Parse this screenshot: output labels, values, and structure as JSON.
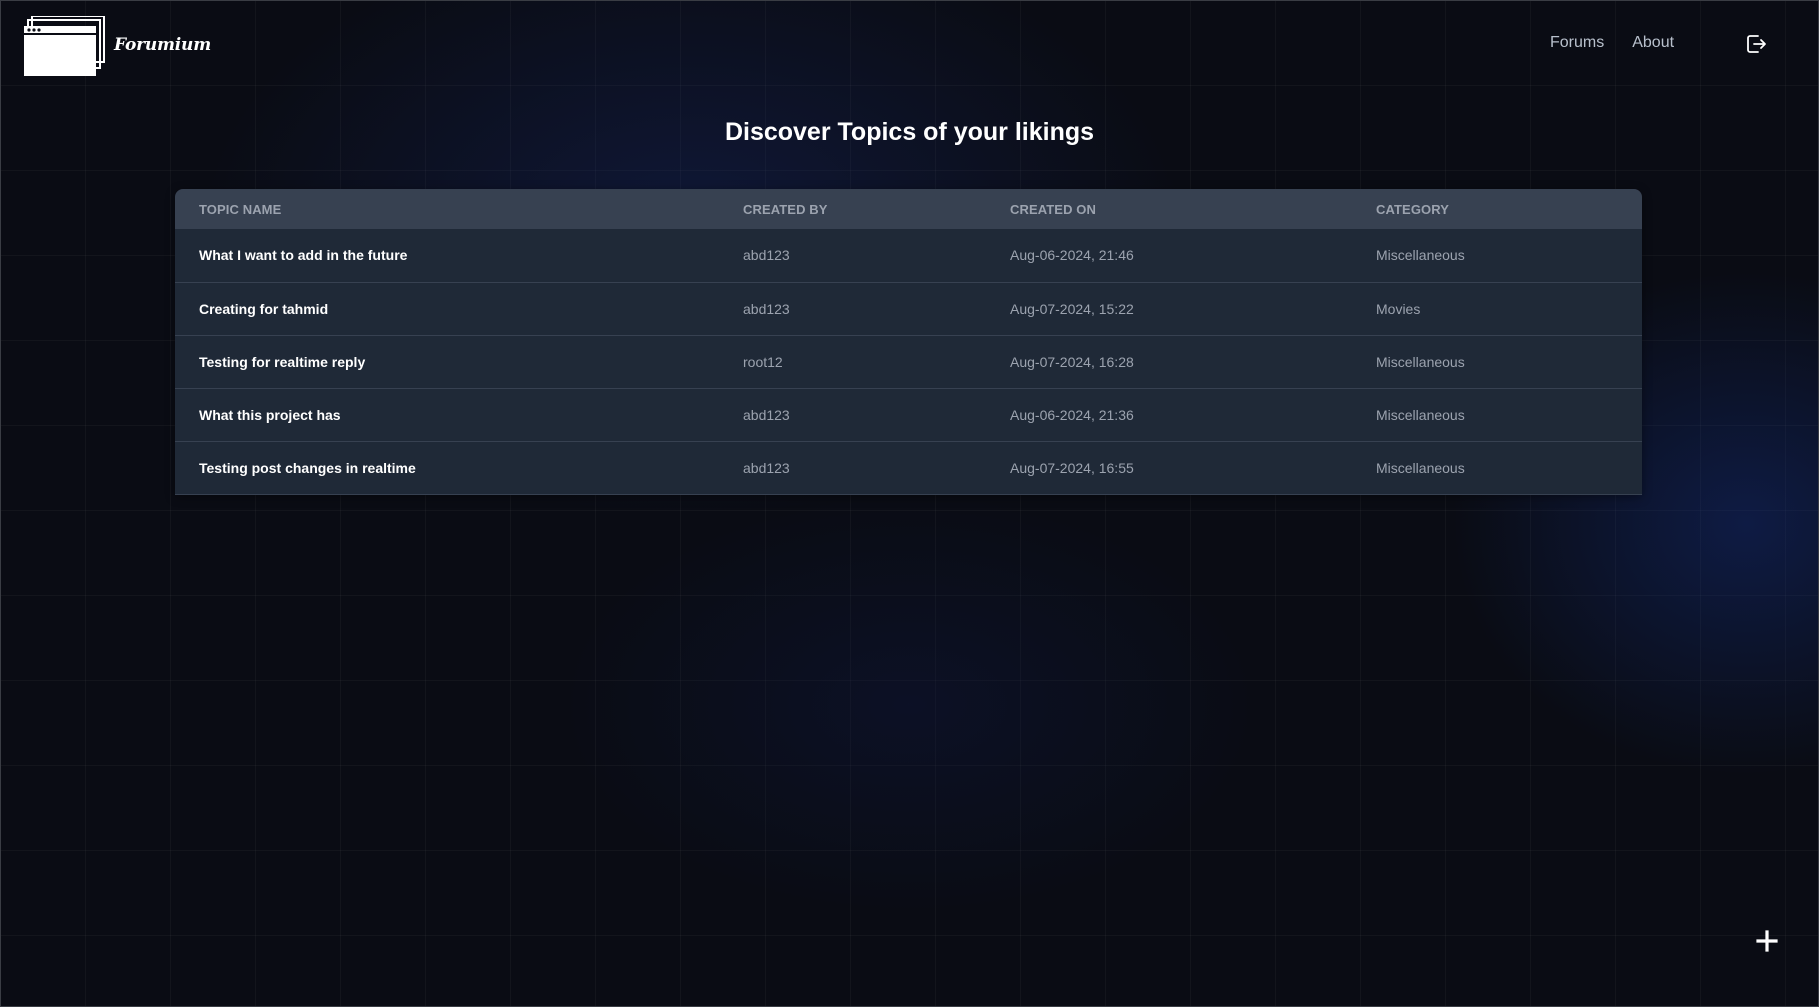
{
  "brand": {
    "name": "Forumium",
    "logo_icon": "browser-windows-icon"
  },
  "nav": {
    "items": [
      {
        "label": "Forums"
      },
      {
        "label": "About"
      }
    ],
    "logout_icon": "logout-icon"
  },
  "main": {
    "title": "Discover Topics of your likings",
    "table": {
      "columns": [
        "TOPIC NAME",
        "CREATED BY",
        "CREATED ON",
        "CATEGORY"
      ],
      "rows": [
        {
          "topic": "What I want to add in the future",
          "created_by": "abd123",
          "created_on": "Aug-06-2024, 21:46",
          "category": "Miscellaneous"
        },
        {
          "topic": "Creating for tahmid",
          "created_by": "abd123",
          "created_on": "Aug-07-2024, 15:22",
          "category": "Movies"
        },
        {
          "topic": "Testing for realtime reply",
          "created_by": "root12",
          "created_on": "Aug-07-2024, 16:28",
          "category": "Miscellaneous"
        },
        {
          "topic": "What this project has",
          "created_by": "abd123",
          "created_on": "Aug-06-2024, 21:36",
          "category": "Miscellaneous"
        },
        {
          "topic": "Testing post changes in realtime",
          "created_by": "abd123",
          "created_on": "Aug-07-2024, 16:55",
          "category": "Miscellaneous"
        }
      ]
    }
  },
  "fab": {
    "icon": "plus-icon"
  },
  "colors": {
    "background": "#0a0c14",
    "table_header": "#374151",
    "table_row": "#1f2937",
    "muted_text": "#9ca3af",
    "nav_text": "#b8c0cc"
  }
}
